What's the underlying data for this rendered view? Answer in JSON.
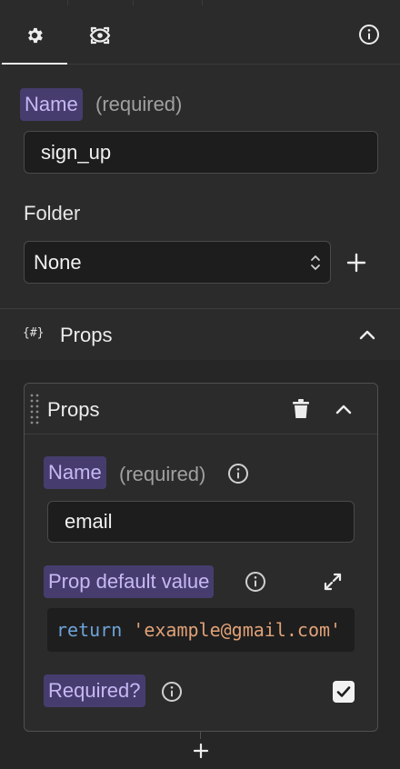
{
  "section": {
    "name_label": "Name",
    "name_hint": "(required)",
    "name_value": "sign_up",
    "folder_label": "Folder",
    "folder_value": "None"
  },
  "props_group": {
    "icon_text": "{#}",
    "title": "Props"
  },
  "prop_card": {
    "title": "Props",
    "name_label": "Name",
    "name_hint": "(required)",
    "name_value": "email",
    "default_label": "Prop default value",
    "default_code_keyword": "return",
    "default_code_value": "'example@gmail.com'",
    "required_label": "Required?",
    "required_checked": true
  },
  "colors": {
    "background": "#2b2b2b",
    "chip_bg": "#463d6e",
    "chip_text": "#c7b8f5",
    "code_keyword": "#6ea3d8",
    "code_string": "#e0a177"
  },
  "icons": [
    "gear-icon",
    "eye-preview-icon",
    "info-icon",
    "chevron-updown-icon",
    "plus-icon",
    "trash-icon",
    "chevron-up-icon",
    "expand-icon",
    "checkbox-checked-icon",
    "drag-handle-icon"
  ]
}
